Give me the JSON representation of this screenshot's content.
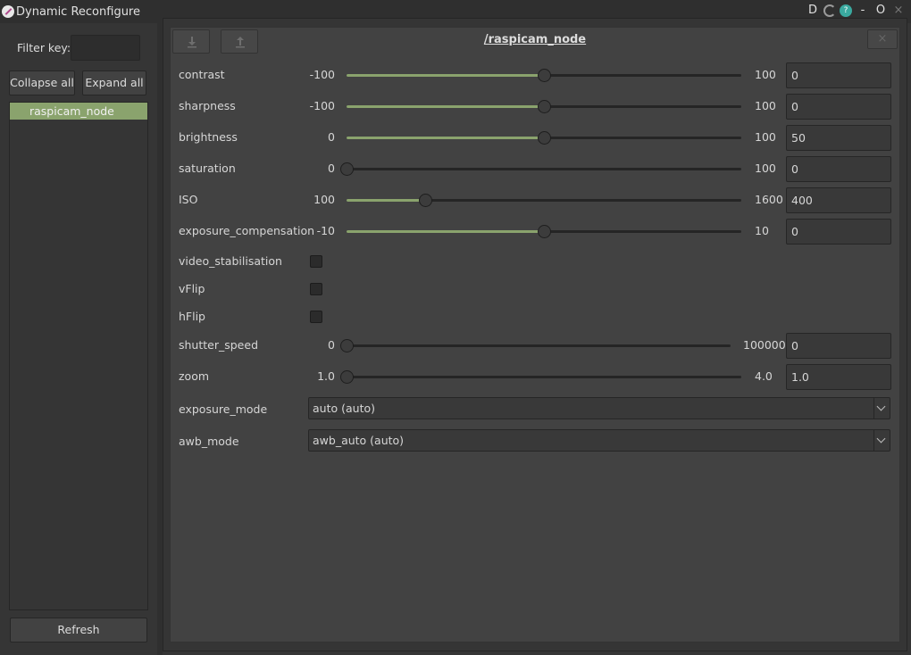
{
  "window": {
    "title": "Dynamic Reconfigure",
    "controls": [
      "D",
      "-",
      "O",
      "×"
    ]
  },
  "sidebar": {
    "filter_label": "Filter key:",
    "filter_value": "",
    "collapse_label": "Collapse all",
    "expand_label": "Expand all",
    "nodes": [
      "raspicam_node"
    ],
    "refresh_label": "Refresh"
  },
  "panel": {
    "node_name": "/raspicam_node",
    "close_symbol": "×"
  },
  "sliders": [
    {
      "name": "contrast",
      "min": "-100",
      "max": "100",
      "value": "0",
      "fraction": 0.5
    },
    {
      "name": "sharpness",
      "min": "-100",
      "max": "100",
      "value": "0",
      "fraction": 0.5
    },
    {
      "name": "brightness",
      "min": "0",
      "max": "100",
      "value": "50",
      "fraction": 0.5
    },
    {
      "name": "saturation",
      "min": "0",
      "max": "100",
      "value": "0",
      "fraction": 0.0
    },
    {
      "name": "ISO",
      "min": "100",
      "max": "1600",
      "value": "400",
      "fraction": 0.2
    },
    {
      "name": "exposure_compensation",
      "min": "-10",
      "max": "10",
      "value": "0",
      "fraction": 0.5
    }
  ],
  "checkboxes": [
    {
      "name": "video_stabilisation",
      "checked": false
    },
    {
      "name": "vFlip",
      "checked": false
    },
    {
      "name": "hFlip",
      "checked": false
    }
  ],
  "sliders2": [
    {
      "name": "shutter_speed",
      "min": "0",
      "max": "100000",
      "value": "0",
      "fraction": 0.0
    },
    {
      "name": "zoom",
      "min": "1.0",
      "max": "4.0",
      "value": "1.0",
      "fraction": 0.0
    }
  ],
  "combos": [
    {
      "name": "exposure_mode",
      "value": "auto (auto)"
    },
    {
      "name": "awb_mode",
      "value": "awb_auto (auto)"
    }
  ],
  "colors": {
    "accent": "#8aa36d",
    "background": "#353535",
    "panel": "#424242"
  }
}
